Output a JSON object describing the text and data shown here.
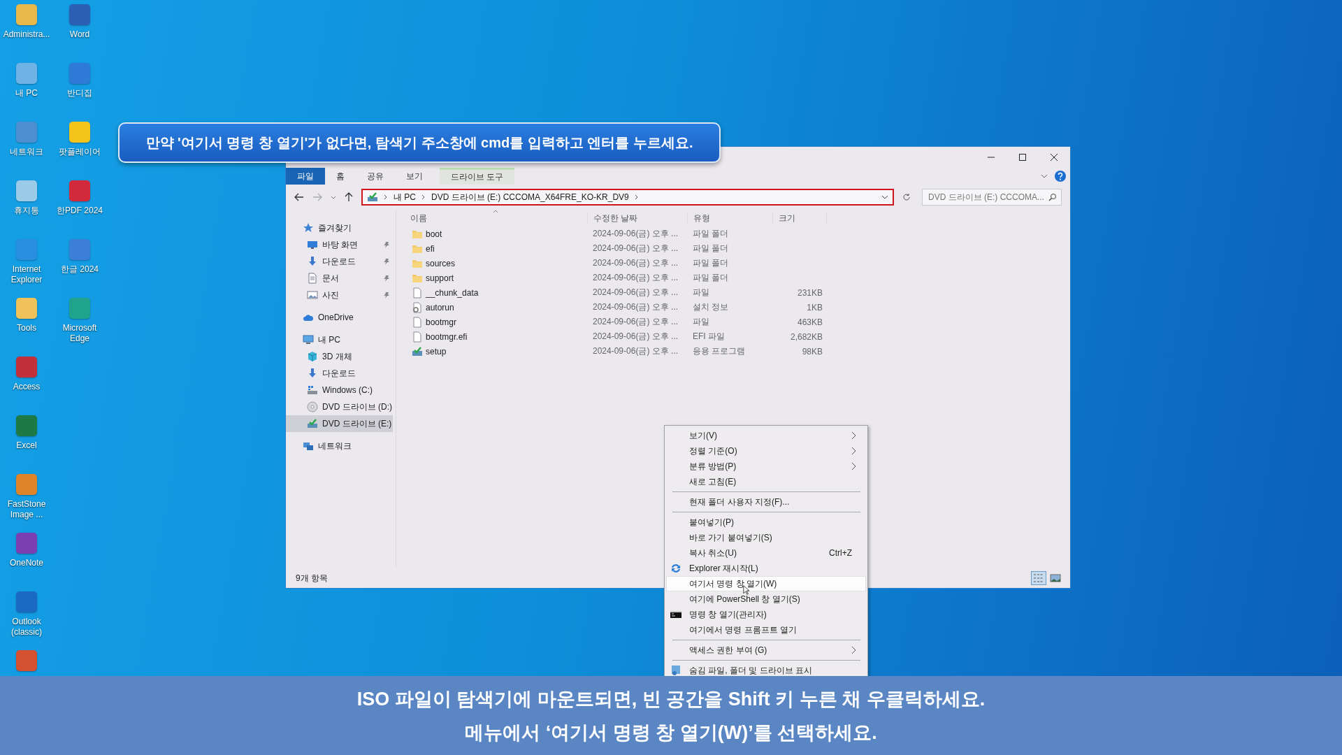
{
  "desktop": {
    "columns": [
      {
        "icons": [
          {
            "label": "Administra...",
            "color": "#e8b84a"
          },
          {
            "label": "내 PC",
            "color": "#6fb3e6"
          },
          {
            "label": "네트워크",
            "color": "#4d8fd1"
          },
          {
            "label": "휴지통",
            "color": "#9ccbe8"
          },
          {
            "label": "Internet Explorer",
            "color": "#2a8ee0"
          },
          {
            "label": "Tools",
            "color": "#f0c35a"
          },
          {
            "label": "Access",
            "color": "#c0313b"
          },
          {
            "label": "Excel",
            "color": "#1e7a45"
          },
          {
            "label": "FastStone Image ...",
            "color": "#e0842a"
          },
          {
            "label": "OneNote",
            "color": "#7b3fb3"
          },
          {
            "label": "Outlook (classic)",
            "color": "#1a6ac2"
          },
          {
            "color": "#d4502f"
          }
        ]
      },
      {
        "icons": [
          {
            "label": "Word",
            "color": "#2b5fb4"
          },
          {
            "label": "반디집",
            "color": "#2d7bd6"
          },
          {
            "label": "팟플레이어",
            "color": "#f3c41c"
          },
          {
            "label": "한PDF 2024",
            "color": "#d22a3a"
          },
          {
            "label": "한글 2024",
            "color": "#3b7fd8"
          },
          {
            "label": "Microsoft Edge",
            "color": "#1fa38a"
          }
        ]
      }
    ]
  },
  "callout": {
    "text": "만약 '여기서 명령 창 열기'가 없다면, 탐색기 주소창에 cmd를 입력하고 엔터를 누르세요."
  },
  "explorer": {
    "ribbon_tabs": [
      {
        "label": "파일",
        "selected": true,
        "kind": "file"
      },
      {
        "label": "홈",
        "selected": false,
        "kind": "tab"
      },
      {
        "label": "공유",
        "selected": false,
        "kind": "tab"
      },
      {
        "label": "보기",
        "selected": false,
        "kind": "tab"
      },
      {
        "label": "드라이브 도구",
        "selected": false,
        "kind": "contextual"
      }
    ],
    "address": {
      "segments": [
        "내 PC",
        "DVD 드라이브 (E:) CCCOMA_X64FRE_KO-KR_DV9"
      ],
      "highlighted": true
    },
    "search": {
      "placeholder": "DVD 드라이브 (E:) CCCOMA..."
    },
    "nav": [
      {
        "label": "즐겨찾기",
        "kind": "star",
        "selected": false,
        "children": [
          {
            "label": "바탕 화면",
            "kind": "monitor",
            "pinned": true,
            "selected": false
          },
          {
            "label": "다운로드",
            "kind": "download",
            "pinned": true,
            "selected": false
          },
          {
            "label": "문서",
            "kind": "document",
            "pinned": true,
            "selected": false
          },
          {
            "label": "사진",
            "kind": "picture",
            "pinned": true,
            "selected": false
          }
        ]
      },
      {
        "label": "OneDrive",
        "kind": "cloud",
        "selected": false
      },
      {
        "label": "내 PC",
        "kind": "pc",
        "selected": false,
        "children": [
          {
            "label": "3D 개체",
            "kind": "cube",
            "pinned": false,
            "selected": false
          },
          {
            "label": "다운로드",
            "kind": "download",
            "pinned": false,
            "selected": false
          },
          {
            "label": "Windows (C:)",
            "kind": "drive",
            "pinned": false,
            "selected": false
          },
          {
            "label": "DVD 드라이브 (D:)",
            "kind": "disc",
            "pinned": false,
            "selected": false
          },
          {
            "label": "DVD 드라이브 (E:)",
            "kind": "dvd",
            "pinned": false,
            "selected": true
          }
        ]
      },
      {
        "label": "네트워크",
        "kind": "network",
        "selected": false
      }
    ],
    "columns": [
      "이름",
      "수정한 날짜",
      "유형",
      "크기"
    ],
    "files": [
      {
        "name": "boot",
        "modified": "2024-09-06(금) 오후 ...",
        "type": "파일 폴더",
        "kind": "folder"
      },
      {
        "name": "efi",
        "modified": "2024-09-06(금) 오후 ...",
        "type": "파일 폴더",
        "kind": "folder"
      },
      {
        "name": "sources",
        "modified": "2024-09-06(금) 오후 ...",
        "type": "파일 폴더",
        "kind": "folder"
      },
      {
        "name": "support",
        "modified": "2024-09-06(금) 오후 ...",
        "type": "파일 폴더",
        "kind": "folder"
      },
      {
        "name": "__chunk_data",
        "modified": "2024-09-06(금) 오후 ...",
        "type": "파일",
        "size": "231KB",
        "kind": "file"
      },
      {
        "name": "autorun",
        "modified": "2024-09-06(금) 오후 ...",
        "type": "설치 정보",
        "size": "1KB",
        "kind": "settings"
      },
      {
        "name": "bootmgr",
        "modified": "2024-09-06(금) 오후 ...",
        "type": "파일",
        "size": "463KB",
        "kind": "file"
      },
      {
        "name": "bootmgr.efi",
        "modified": "2024-09-06(금) 오후 ...",
        "type": "EFI 파일",
        "size": "2,682KB",
        "kind": "file"
      },
      {
        "name": "setup",
        "modified": "2024-09-06(금) 오후 ...",
        "type": "응용 프로그램",
        "size": "98KB",
        "kind": "app"
      }
    ],
    "status": "9개 항목",
    "view_buttons": [
      {
        "kind": "details",
        "selected": true
      },
      {
        "kind": "large",
        "selected": false
      }
    ]
  },
  "context_menu": {
    "items": [
      {
        "kind": "item",
        "label": "보기(V)",
        "submenu": true,
        "selected": false
      },
      {
        "kind": "item",
        "label": "정렬 기준(O)",
        "submenu": true,
        "selected": false
      },
      {
        "kind": "item",
        "label": "분류 방법(P)",
        "submenu": true,
        "selected": false
      },
      {
        "kind": "item",
        "label": "새로 고침(E)",
        "submenu": false,
        "selected": false
      },
      {
        "kind": "separator"
      },
      {
        "kind": "item",
        "label": "현재 폴더 사용자 지정(F)...",
        "submenu": false,
        "selected": false
      },
      {
        "kind": "separator"
      },
      {
        "kind": "item",
        "label": "붙여넣기(P)",
        "submenu": false,
        "selected": false
      },
      {
        "kind": "item",
        "label": "바로 가기 붙여넣기(S)",
        "submenu": false,
        "selected": false
      },
      {
        "kind": "item",
        "label": "복사 취소(U)",
        "shortcut": "Ctrl+Z",
        "submenu": false,
        "selected": false
      },
      {
        "kind": "refresh",
        "label": "Explorer 재시작(L)",
        "submenu": false,
        "selected": false
      },
      {
        "kind": "item",
        "label": "여기서 명령 창 열기(W)",
        "submenu": false,
        "selected": true
      },
      {
        "kind": "item",
        "label": "여기에 PowerShell 창 열기(S)",
        "submenu": false,
        "selected": false
      },
      {
        "kind": "console",
        "label": "명령 창 열기(관리자)",
        "submenu": false,
        "selected": false
      },
      {
        "kind": "item",
        "label": "여기에서 명령 프롬프트 열기",
        "submenu": false,
        "selected": false
      },
      {
        "kind": "separator"
      },
      {
        "kind": "item",
        "label": "액세스 권한 부여 (G)",
        "submenu": true,
        "selected": false
      },
      {
        "kind": "separator"
      },
      {
        "kind": "window",
        "label": "숨김 파일, 폴더 및 드라이브 표시",
        "submenu": false,
        "selected": false
      }
    ]
  },
  "caption": {
    "lines": [
      "ISO 파일이 탐색기에 마운트되면, 빈 공간을 Shift 키 누른 채 우클릭하세요.",
      "메뉴에서 ‘여기서 명령 창 열기(W)’를 선택하세요."
    ]
  }
}
